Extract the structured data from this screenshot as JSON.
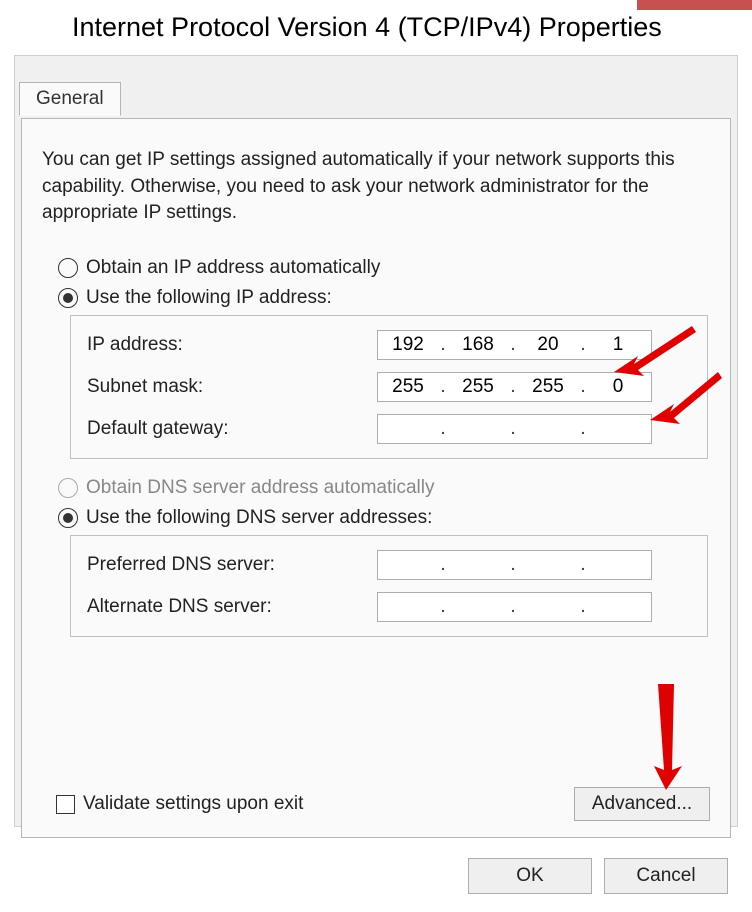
{
  "window": {
    "title": "Internet Protocol Version 4 (TCP/IPv4) Properties"
  },
  "tab": {
    "label": "General"
  },
  "description": "You can get IP settings assigned automatically if your network supports this capability. Otherwise, you need to ask your network administrator for the appropriate IP settings.",
  "ip_section": {
    "auto_label": "Obtain an IP address automatically",
    "manual_label": "Use the following IP address:",
    "ip_label": "IP address:",
    "mask_label": "Subnet mask:",
    "gateway_label": "Default gateway:",
    "ip": {
      "o1": "192",
      "o2": "168",
      "o3": "20",
      "o4": "1"
    },
    "mask": {
      "o1": "255",
      "o2": "255",
      "o3": "255",
      "o4": "0"
    },
    "gateway": {
      "o1": "",
      "o2": "",
      "o3": "",
      "o4": ""
    }
  },
  "dns_section": {
    "auto_label": "Obtain DNS server address automatically",
    "manual_label": "Use the following DNS server addresses:",
    "preferred_label": "Preferred DNS server:",
    "alternate_label": "Alternate DNS server:",
    "preferred": {
      "o1": "",
      "o2": "",
      "o3": "",
      "o4": ""
    },
    "alternate": {
      "o1": "",
      "o2": "",
      "o3": "",
      "o4": ""
    }
  },
  "validate_label": "Validate settings upon exit",
  "buttons": {
    "advanced": "Advanced...",
    "ok": "OK",
    "cancel": "Cancel"
  }
}
